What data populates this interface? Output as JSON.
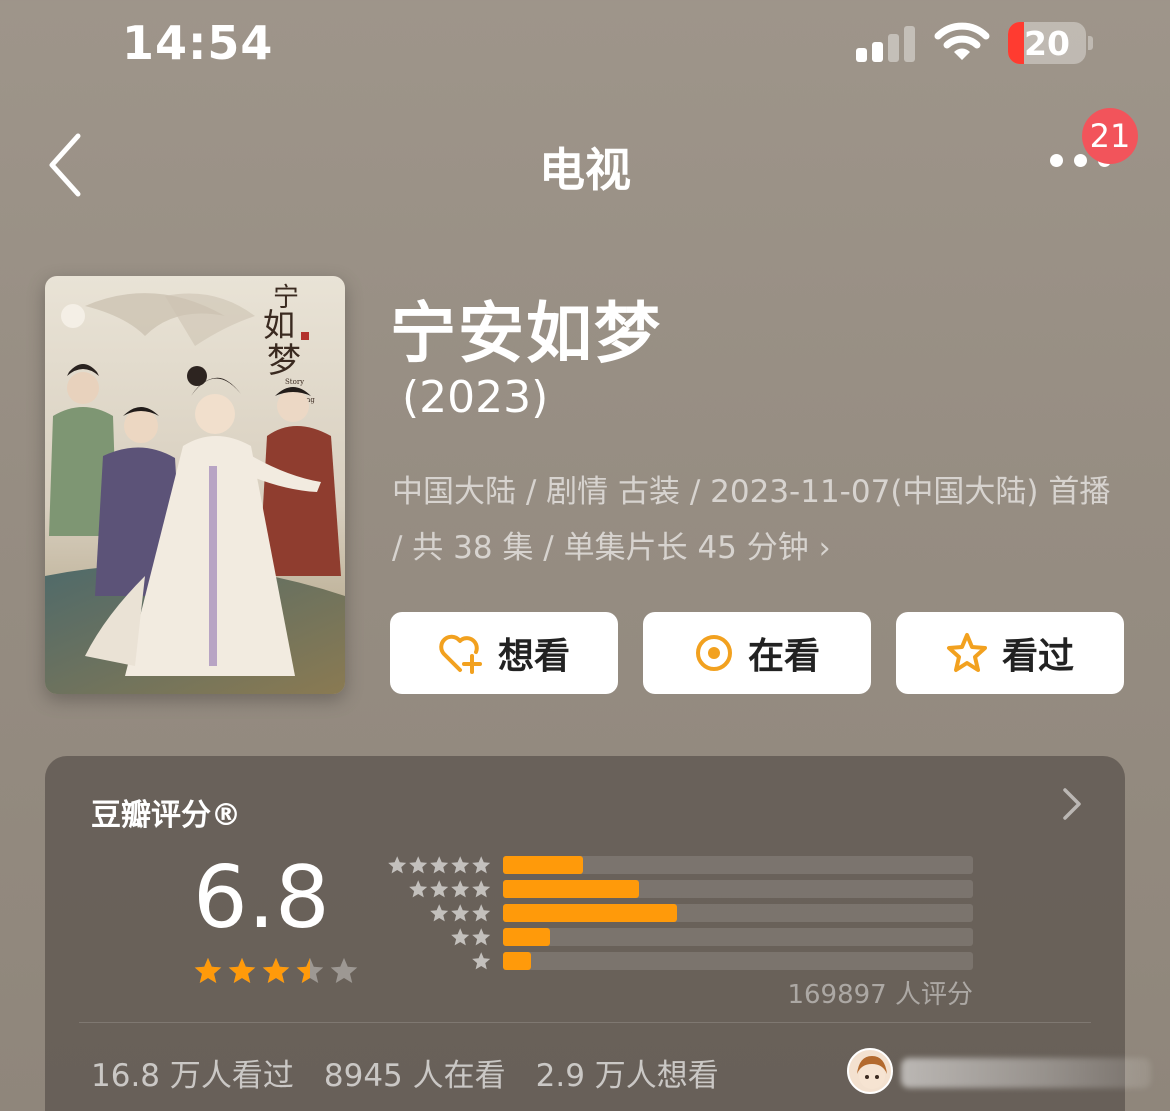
{
  "status_bar": {
    "time": "14:54",
    "battery": "20",
    "signal_bars": 2,
    "signal_total": 4
  },
  "nav": {
    "title": "电视",
    "badge": "21",
    "back_icon": "chevron-left-icon",
    "more_icon": "ellipsis-icon"
  },
  "show": {
    "title": "宁安如梦",
    "year": "(2023)",
    "meta": "中国大陆 / 剧情 古装 / 2023-11-07(中国大陆) 首播 / 共 38 集 / 单集片长 45 分钟",
    "meta_chevron": "›",
    "poster_title": "宁安如梦",
    "poster_subtitle": "Story of Kunning Palace"
  },
  "actions": [
    {
      "label": "想看",
      "icon": "heart-plus-icon"
    },
    {
      "label": "在看",
      "icon": "target-icon"
    },
    {
      "label": "看过",
      "icon": "star-outline-icon"
    }
  ],
  "rating": {
    "title": "豆瓣评分®",
    "score": "6.8",
    "stars": 3.5,
    "distribution": [
      {
        "stars": 5,
        "fraction": 0.17
      },
      {
        "stars": 4,
        "fraction": 0.29
      },
      {
        "stars": 3,
        "fraction": 0.37
      },
      {
        "stars": 2,
        "fraction": 0.1
      },
      {
        "stars": 1,
        "fraction": 0.06
      }
    ],
    "count": "169897 人评分",
    "stats": {
      "watched": "16.8 万人看过",
      "watching": "8945 人在看",
      "wish": "2.9 万人想看"
    }
  },
  "colors": {
    "accent": "#ff9a0a",
    "badge": "#f2545b",
    "battery_low": "#ff3b30"
  }
}
